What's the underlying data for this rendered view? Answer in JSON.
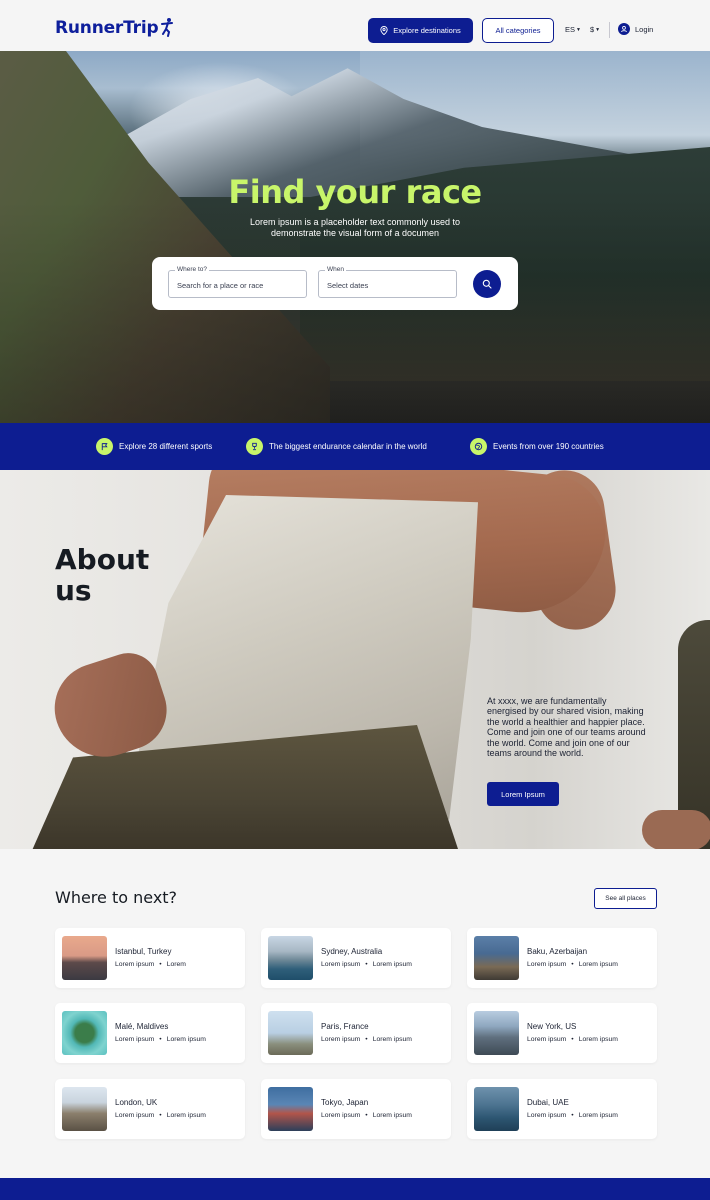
{
  "header": {
    "logo_text": "RunnerTrip",
    "explore_label": "Explore destinations",
    "categories_label": "All categories",
    "language": "ES",
    "currency": "$",
    "login_label": "Login"
  },
  "hero": {
    "title": "Find your race",
    "subtitle": "Lorem ipsum is a placeholder text  commonly used to demonstrate the visual form of a documen",
    "where_label": "Where to?",
    "where_placeholder": "Search for a place or race",
    "when_label": "When",
    "when_placeholder": "Select dates"
  },
  "features": [
    {
      "label": "Explore 28 different sports",
      "icon": "flag-icon"
    },
    {
      "label": "The biggest endurance calendar in the world",
      "icon": "trophy-icon"
    },
    {
      "label": "Events from over 190 countries",
      "icon": "globe-icon"
    }
  ],
  "about": {
    "title_line1": "About",
    "title_line2": "us",
    "text": "At xxxx, we are fundamentally energised by our shared vision, making the world a healthier and happier place. Come and join one of our teams around the world. Come and join one of our teams around the world.",
    "button_label": "Lorem Ipsum"
  },
  "destinations": {
    "title": "Where to next?",
    "see_all_label": "See all places",
    "items": [
      {
        "name": "Istanbul, Turkey",
        "meta1": "Lorem ipsum",
        "meta2": "Lorem"
      },
      {
        "name": "Sydney, Australia",
        "meta1": "Lorem ipsum",
        "meta2": "Lorem ipsum"
      },
      {
        "name": "Baku, Azerbaijan",
        "meta1": "Lorem ipsum",
        "meta2": "Lorem ipsum"
      },
      {
        "name": "Malé, Maldives",
        "meta1": "Lorem ipsum",
        "meta2": "Lorem ipsum"
      },
      {
        "name": "Paris, France",
        "meta1": "Lorem ipsum",
        "meta2": "Lorem ipsum"
      },
      {
        "name": "New York, US",
        "meta1": "Lorem ipsum",
        "meta2": "Lorem ipsum"
      },
      {
        "name": "London, UK",
        "meta1": "Lorem ipsum",
        "meta2": "Lorem ipsum"
      },
      {
        "name": "Tokyo, Japan",
        "meta1": "Lorem ipsum",
        "meta2": "Lorem ipsum"
      },
      {
        "name": "Dubai, UAE",
        "meta1": "Lorem ipsum",
        "meta2": "Lorem ipsum"
      }
    ]
  },
  "colors": {
    "brand_blue": "#0d1d91",
    "accent_lime": "#c8f56a",
    "background": "#f5f5f5"
  }
}
